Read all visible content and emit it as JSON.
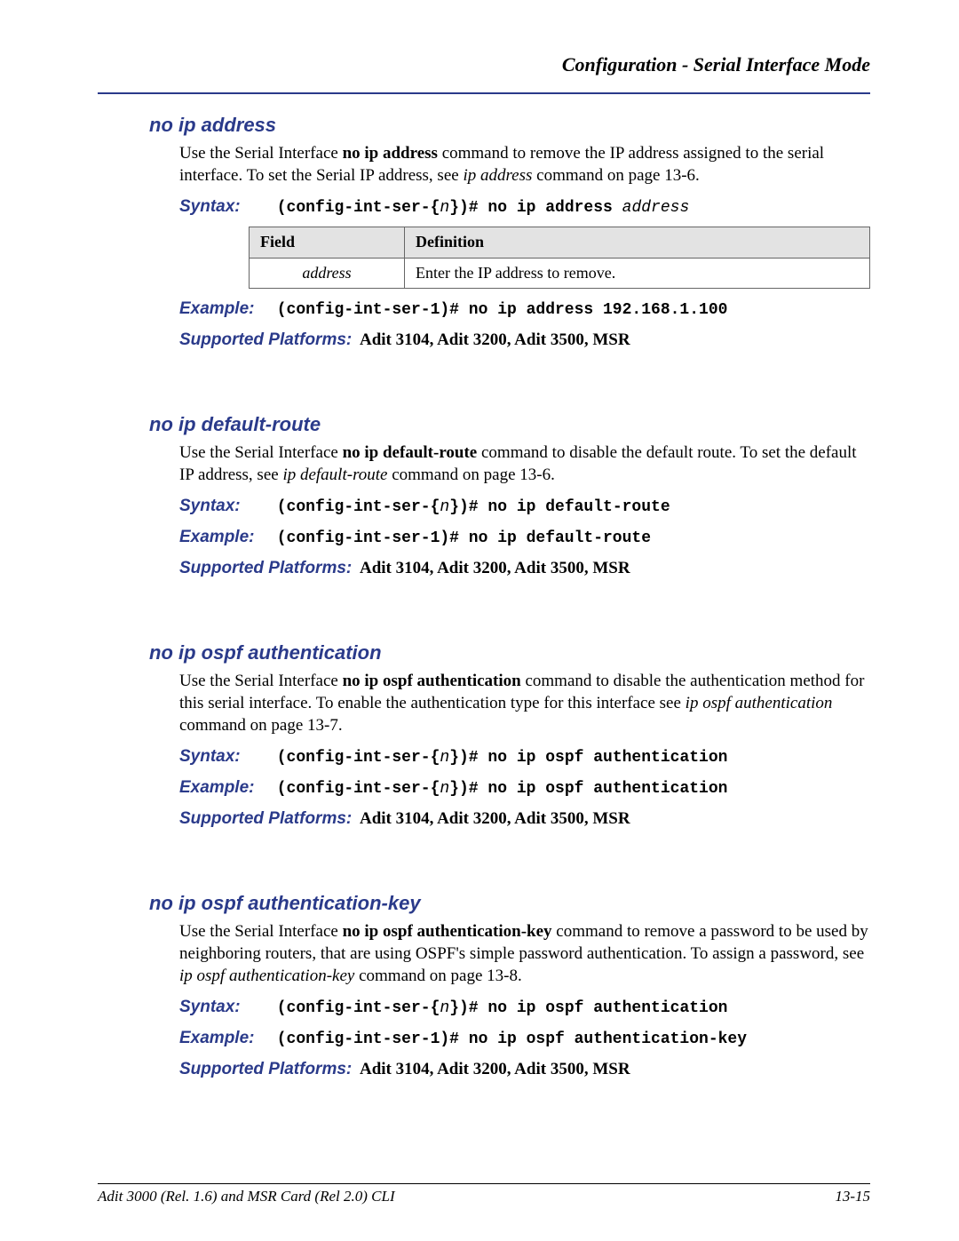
{
  "header": {
    "title": "Configuration - Serial Interface Mode"
  },
  "labels": {
    "syntax": "Syntax:",
    "example": "Example:",
    "supported_platforms": "Supported Platforms:"
  },
  "sections": [
    {
      "title": "no ip address",
      "desc_pre": "Use the Serial Interface ",
      "desc_bold": "no ip address",
      "desc_mid": " command to remove the IP address assigned to the serial interface. To set the Serial IP address, see ",
      "desc_italic_ref": "ip address",
      "desc_post": " command on page 13-6.",
      "syntax_prefix": "(config-int-ser-{",
      "syntax_n": "n",
      "syntax_suffix": "})# no ip address ",
      "syntax_trailing_italic": "address",
      "table": {
        "h1": "Field",
        "h2": "Definition",
        "r1c1": "address",
        "r1c2": "Enter the IP address to remove."
      },
      "example": "(config-int-ser-1)# no ip address 192.168.1.100",
      "platforms": "Adit 3104, Adit 3200, Adit 3500, MSR"
    },
    {
      "title": "no ip default-route",
      "desc_pre": "Use the Serial Interface ",
      "desc_bold": "no ip default-route",
      "desc_mid": " command to disable the default route. To set the default IP address, see ",
      "desc_italic_ref": "ip default-route",
      "desc_post": " command on page 13-6.",
      "syntax_prefix": "(config-int-ser-{",
      "syntax_n": "n",
      "syntax_suffix": "})# no ip default-route",
      "example": "(config-int-ser-1)# no ip default-route",
      "platforms": "Adit 3104, Adit 3200, Adit 3500, MSR"
    },
    {
      "title": "no ip ospf authentication",
      "desc_pre": "Use the Serial Interface ",
      "desc_bold": "no ip ospf authentication",
      "desc_mid": " command to disable the authentication method for this serial interface. To enable the authentication type for this interface see ",
      "desc_italic_ref": "ip ospf authentication",
      "desc_post": " command on page 13-7.",
      "syntax_prefix": "(config-int-ser-{",
      "syntax_n": "n",
      "syntax_suffix": "})# no ip ospf authentication",
      "example_prefix": "(config-int-ser-{",
      "example_n": "n",
      "example_suffix": "})# no ip ospf authentication",
      "platforms": "Adit 3104, Adit 3200, Adit 3500, MSR"
    },
    {
      "title": "no ip ospf authentication-key",
      "desc_pre": "Use the Serial Interface ",
      "desc_bold": "no ip ospf authentication-key",
      "desc_mid": " command to remove a password to be used by neighboring routers, that are using OSPF's simple password authentication. To assign a password, see ",
      "desc_italic_ref": "ip ospf authentication-key",
      "desc_post": " command on page 13-8.",
      "syntax_prefix": "(config-int-ser-{",
      "syntax_n": "n",
      "syntax_suffix": "})# no ip ospf authentication",
      "example": "(config-int-ser-1)# no ip ospf authentication-key",
      "platforms": "Adit 3104, Adit 3200, Adit 3500, MSR"
    }
  ],
  "footer": {
    "left": "Adit 3000 (Rel. 1.6) and MSR Card (Rel 2.0) CLI",
    "right": "13-15"
  }
}
